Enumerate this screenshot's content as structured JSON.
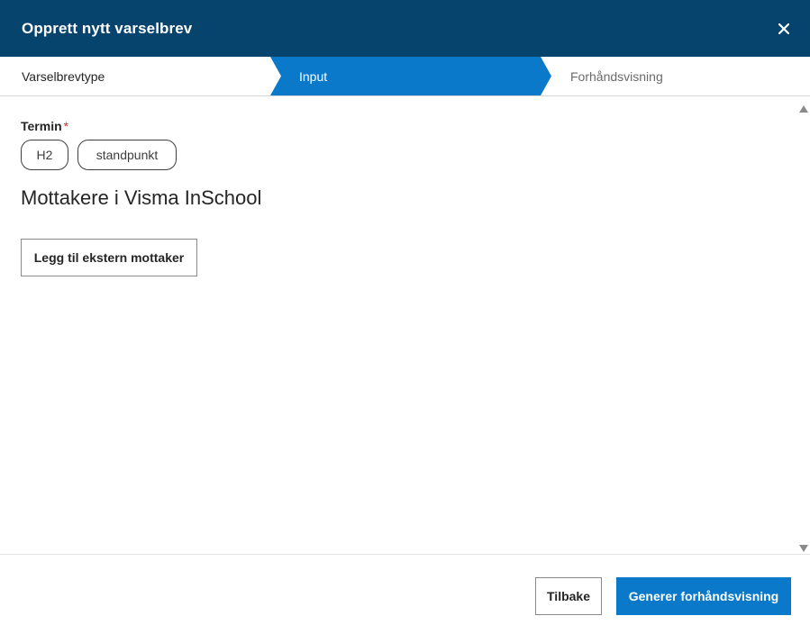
{
  "dialog": {
    "title": "Opprett nytt varselbrev",
    "close_icon": "close-icon"
  },
  "stepper": {
    "steps": [
      {
        "label": "Varselbrevtype",
        "state": "completed"
      },
      {
        "label": "Input",
        "state": "active"
      },
      {
        "label": "Forhåndsvisning",
        "state": "upcoming"
      }
    ],
    "active_color": "#0a79c9"
  },
  "form": {
    "termin_label": "Termin",
    "required_marker": "*",
    "termin_chips": [
      "H2",
      "standpunkt"
    ],
    "recipients_heading": "Mottakere i Visma InSchool",
    "add_external_label": "Legg til ekstern mottaker"
  },
  "footer": {
    "back_label": "Tilbake",
    "generate_label": "Generer forhåndsvisning"
  },
  "colors": {
    "header_bg": "#06436d",
    "primary": "#0a79c9",
    "required": "#c0392b"
  }
}
